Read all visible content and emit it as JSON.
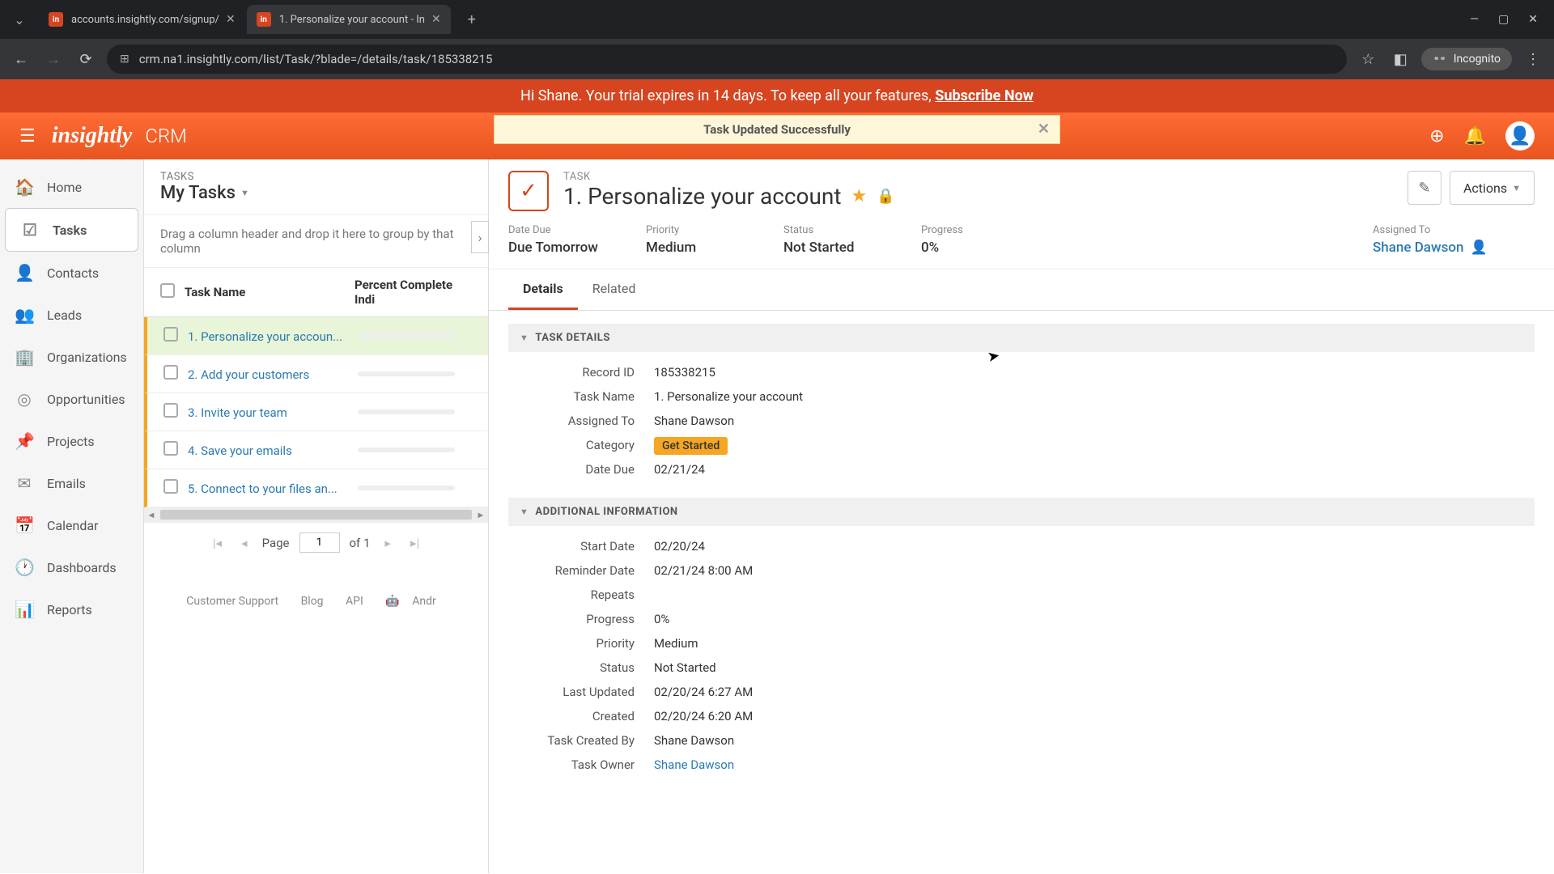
{
  "browser": {
    "tabs": [
      {
        "title": "accounts.insightly.com/signup/"
      },
      {
        "title": "1. Personalize your account - In"
      }
    ],
    "url": "crm.na1.insightly.com/list/Task/?blade=/details/task/185338215",
    "incognito_label": "Incognito"
  },
  "trial_banner": {
    "text_before": "Hi Shane. Your trial expires in 14 days. To keep all your features, ",
    "link": "Subscribe Now"
  },
  "header": {
    "logo": "insightly",
    "app_name": "CRM"
  },
  "toast": {
    "message": "Task Updated Successfully"
  },
  "sidebar": {
    "items": [
      {
        "label": "Home"
      },
      {
        "label": "Tasks"
      },
      {
        "label": "Contacts"
      },
      {
        "label": "Leads"
      },
      {
        "label": "Organizations"
      },
      {
        "label": "Opportunities"
      },
      {
        "label": "Projects"
      },
      {
        "label": "Emails"
      },
      {
        "label": "Calendar"
      },
      {
        "label": "Dashboards"
      },
      {
        "label": "Reports"
      }
    ]
  },
  "list": {
    "category": "TASKS",
    "title": "My Tasks",
    "drag_hint": "Drag a column header and drop it here to group by that column",
    "columns": {
      "name": "Task Name",
      "pct": "Percent Complete Indi"
    },
    "rows": [
      {
        "name": "1. Personalize your accoun..."
      },
      {
        "name": "2. Add your customers"
      },
      {
        "name": "3. Invite your team"
      },
      {
        "name": "4. Save your emails"
      },
      {
        "name": "5. Connect to your files an..."
      }
    ],
    "pagination": {
      "page_label": "Page",
      "page": "1",
      "of_label": "of 1"
    },
    "footer": {
      "support": "Customer Support",
      "blog": "Blog",
      "api": "API",
      "android": "Andr"
    }
  },
  "detail": {
    "category": "TASK",
    "title": "1. Personalize your account",
    "actions_label": "Actions",
    "summary": {
      "date_due": {
        "label": "Date Due",
        "value": "Due Tomorrow"
      },
      "priority": {
        "label": "Priority",
        "value": "Medium"
      },
      "status": {
        "label": "Status",
        "value": "Not Started"
      },
      "progress": {
        "label": "Progress",
        "value": "0%"
      },
      "assigned": {
        "label": "Assigned To",
        "value": "Shane Dawson"
      }
    },
    "tabs": {
      "details": "Details",
      "related": "Related"
    },
    "sections": {
      "task_details": {
        "title": "TASK DETAILS",
        "fields": [
          {
            "label": "Record ID",
            "value": "185338215"
          },
          {
            "label": "Task Name",
            "value": "1. Personalize your account"
          },
          {
            "label": "Assigned To",
            "value": "Shane Dawson"
          },
          {
            "label": "Category",
            "value": "Get Started",
            "badge": true
          },
          {
            "label": "Date Due",
            "value": "02/21/24"
          }
        ]
      },
      "additional": {
        "title": "ADDITIONAL INFORMATION",
        "fields": [
          {
            "label": "Start Date",
            "value": "02/20/24"
          },
          {
            "label": "Reminder Date",
            "value": "02/21/24 8:00 AM"
          },
          {
            "label": "Repeats",
            "value": ""
          },
          {
            "label": "Progress",
            "value": "0%"
          },
          {
            "label": "Priority",
            "value": "Medium"
          },
          {
            "label": "Status",
            "value": "Not Started"
          },
          {
            "label": "Last Updated",
            "value": "02/20/24 6:27 AM"
          },
          {
            "label": "Created",
            "value": "02/20/24 6:20 AM"
          },
          {
            "label": "Task Created By",
            "value": "Shane Dawson"
          },
          {
            "label": "Task Owner",
            "value": "Shane Dawson",
            "link": true
          }
        ]
      }
    }
  }
}
